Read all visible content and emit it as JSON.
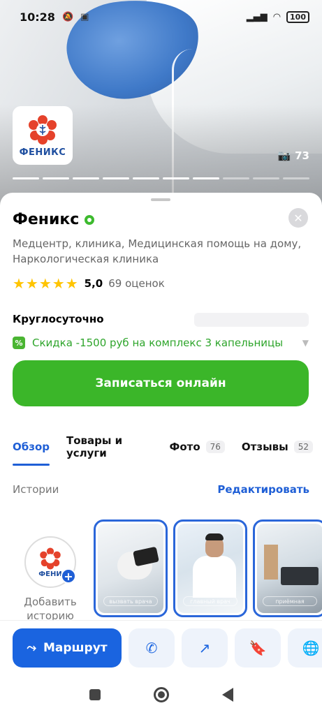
{
  "status_bar": {
    "time": "10:28",
    "battery": "100"
  },
  "hero": {
    "photo_count": "73",
    "progress_total": 10,
    "progress_done": 7
  },
  "logo": {
    "text": "ФЕНИКС"
  },
  "place": {
    "title": "Феникс",
    "description": "Медцентр, клиника, Медицинская помощь на дому, Наркологическая клиника",
    "stars": "★★★★★",
    "rating": "5,0",
    "reviews": "69 оценок",
    "hours": "Круглосуточно",
    "promo_icon": "%",
    "promo": "Скидка -1500 руб на комплекс 3 капельницы"
  },
  "book_button": "Записаться онлайн",
  "tabs": [
    {
      "label": "Обзор",
      "count": ""
    },
    {
      "label": "Товары и услуги",
      "count": ""
    },
    {
      "label": "Фото",
      "count": "76"
    },
    {
      "label": "Отзывы",
      "count": "52"
    }
  ],
  "stories": {
    "title": "Истории",
    "edit": "Редактировать",
    "add_label": "Добавить историю",
    "add_logo_text": "ФЕНИ",
    "items": [
      {
        "caption": "вызвать врача"
      },
      {
        "caption": "главный врач"
      },
      {
        "caption": "приёмная"
      }
    ]
  },
  "actions": {
    "route": "Маршрут"
  },
  "colors": {
    "accent_blue": "#1a64e0",
    "accent_green": "#3bb629",
    "star": "#ffc400"
  }
}
